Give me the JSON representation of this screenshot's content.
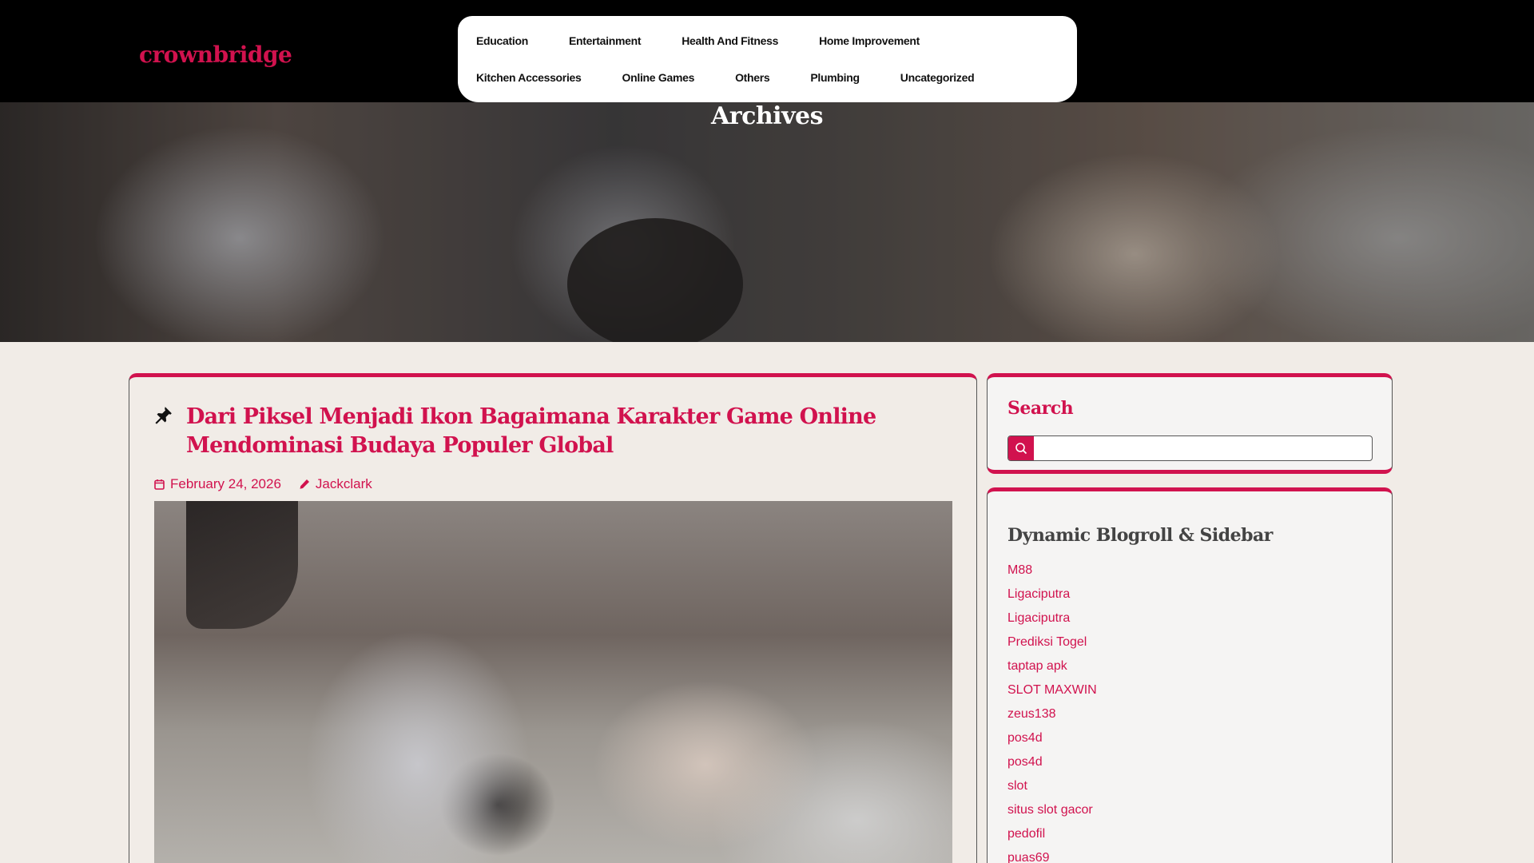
{
  "site": {
    "logo": "crownbridge"
  },
  "nav": {
    "row1": [
      "Education",
      "Entertainment",
      "Health And Fitness",
      "Home Improvement"
    ],
    "row2": [
      "Kitchen Accessories",
      "Online Games",
      "Others",
      "Plumbing",
      "Uncategorized"
    ]
  },
  "hero": {
    "title": "Archives"
  },
  "post": {
    "title": "Dari Piksel Menjadi Ikon Bagaimana Karakter Game Online Mendominasi Budaya Populer Global",
    "date": "February 24, 2026",
    "author": "Jackclark"
  },
  "sidebar": {
    "search_title": "Search",
    "search_placeholder": "",
    "blogroll_title": "Dynamic Blogroll & Sidebar",
    "links": [
      "M88",
      "Ligaciputra",
      "Ligaciputra",
      "Prediksi Togel",
      "taptap apk",
      "SLOT MAXWIN",
      "zeus138",
      "pos4d",
      "pos4d",
      "slot",
      "situs slot gacor",
      "pedofil",
      "puas69"
    ]
  },
  "colors": {
    "accent": "#d1124e",
    "header_bg": "#000000",
    "page_bg": "#f1ece7"
  },
  "icons": {
    "pin": "pushpin-icon",
    "date": "calendar-icon",
    "author": "pencil-icon",
    "search": "search-icon"
  }
}
